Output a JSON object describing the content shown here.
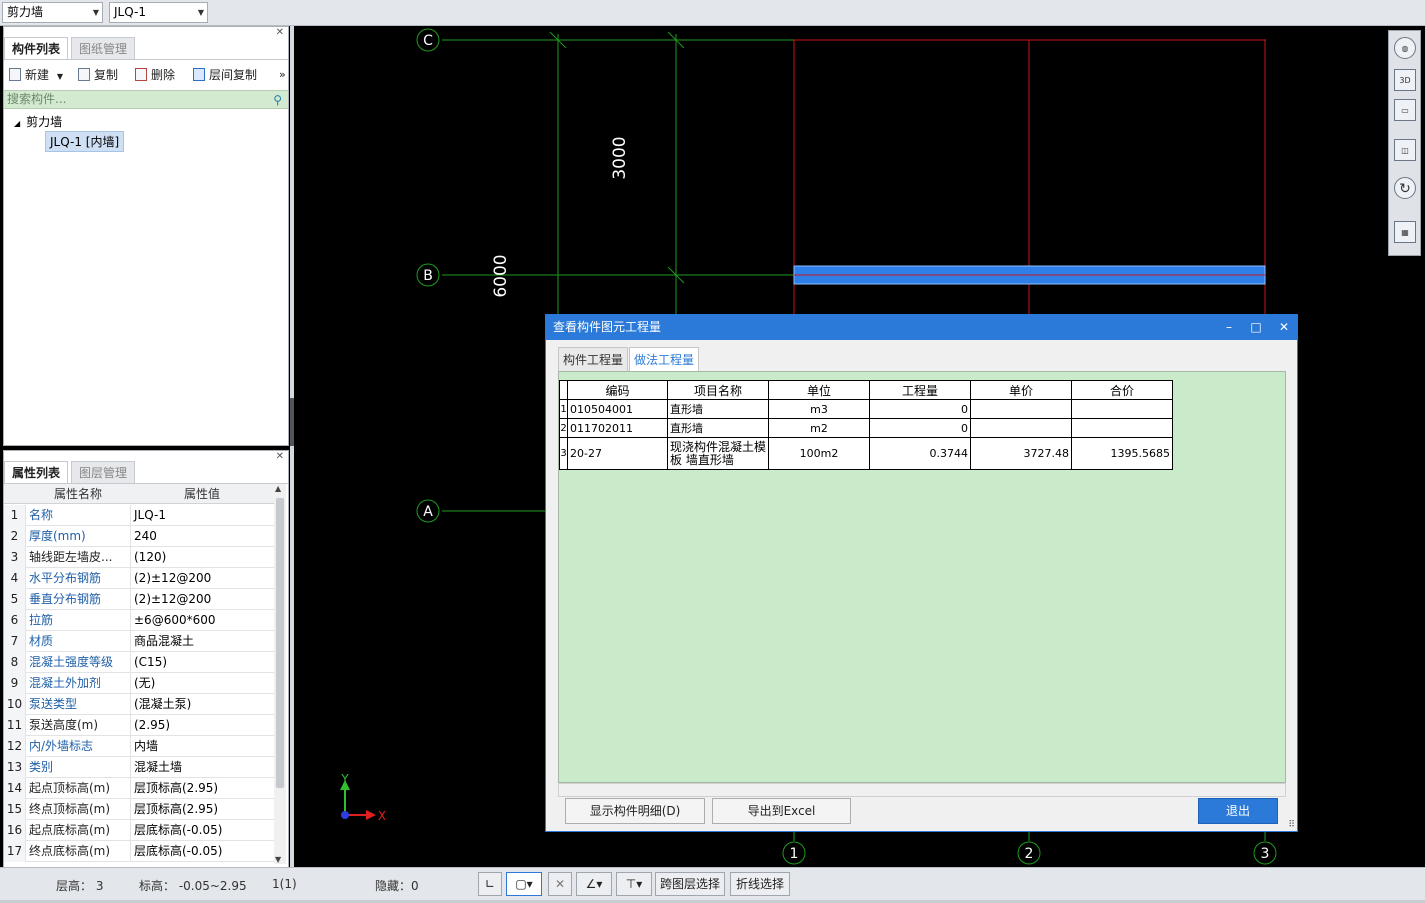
{
  "top_bar": {
    "category_combo": "剪力墙",
    "component_combo": "JLQ-1"
  },
  "component_panel": {
    "tabs": [
      "构件列表",
      "图纸管理"
    ],
    "toolbar": {
      "new_label": "新建",
      "copy_label": "复制",
      "delete_label": "删除",
      "floor_copy_label": "层间复制",
      "more_label": "»"
    },
    "search_placeholder": "搜索构件...",
    "tree": {
      "root": "剪力墙",
      "child": "JLQ-1 [内墙]"
    }
  },
  "property_panel": {
    "tabs": [
      "属性列表",
      "图层管理"
    ],
    "header_name": "属性名称",
    "header_value": "属性值",
    "rows": [
      {
        "num": "1",
        "name": "名称",
        "value": "JLQ-1",
        "blue": true
      },
      {
        "num": "2",
        "name": "厚度(mm)",
        "value": "240",
        "blue": true
      },
      {
        "num": "3",
        "name": "轴线距左墙皮...",
        "value": "(120)",
        "blue": false
      },
      {
        "num": "4",
        "name": "水平分布钢筋",
        "value": "(2)±12@200",
        "blue": true
      },
      {
        "num": "5",
        "name": "垂直分布钢筋",
        "value": "(2)±12@200",
        "blue": true
      },
      {
        "num": "6",
        "name": "拉筋",
        "value": "±6@600*600",
        "blue": true
      },
      {
        "num": "7",
        "name": "材质",
        "value": "商品混凝土",
        "blue": true
      },
      {
        "num": "8",
        "name": "混凝土强度等级",
        "value": "(C15)",
        "blue": true
      },
      {
        "num": "9",
        "name": "混凝土外加剂",
        "value": "(无)",
        "blue": true
      },
      {
        "num": "10",
        "name": "泵送类型",
        "value": "(混凝土泵)",
        "blue": true
      },
      {
        "num": "11",
        "name": "泵送高度(m)",
        "value": "(2.95)",
        "blue": false
      },
      {
        "num": "12",
        "name": "内/外墙标志",
        "value": "内墙",
        "blue": true
      },
      {
        "num": "13",
        "name": "类别",
        "value": "混凝土墙",
        "blue": true
      },
      {
        "num": "14",
        "name": "起点顶标高(m)",
        "value": "层顶标高(2.95)",
        "blue": false
      },
      {
        "num": "15",
        "name": "终点顶标高(m)",
        "value": "层顶标高(2.95)",
        "blue": false
      },
      {
        "num": "16",
        "name": "起点底标高(m)",
        "value": "层底标高(-0.05)",
        "blue": false
      },
      {
        "num": "17",
        "name": "终点底标高(m)",
        "value": "层底标高(-0.05)",
        "blue": false
      }
    ]
  },
  "canvas": {
    "axis_labels": {
      "c": "C",
      "b": "B",
      "a": "A",
      "n1": "1",
      "n2": "2",
      "n3": "3"
    },
    "dim_3000": "3000",
    "dim_6000": "6000",
    "ucs_x": "X",
    "ucs_y": "Y",
    "colors": {
      "grid": "#1f9a1f",
      "wall_red": "#c8141e",
      "wall_blue": "#2f7fe8"
    }
  },
  "view_tools": {
    "label_3d": "3D"
  },
  "dialog": {
    "title": "查看构件图元工程量",
    "minimize": "–",
    "maximize": "□",
    "close": "✕",
    "tabs": [
      "构件工程量",
      "做法工程量"
    ],
    "table": {
      "headers": [
        "编码",
        "项目名称",
        "单位",
        "工程量",
        "单价",
        "合价"
      ],
      "rows": [
        {
          "idx": "1",
          "code": "010504001",
          "name": "直形墙",
          "unit": "m3",
          "qty": "0",
          "price": "",
          "total": ""
        },
        {
          "idx": "2",
          "code": "011702011",
          "name": "直形墙",
          "unit": "m2",
          "qty": "0",
          "price": "",
          "total": ""
        },
        {
          "idx": "3",
          "code": "20-27",
          "name": "现浇构件混凝土模板 墙直形墙",
          "unit": "100m2",
          "qty": "0.3744",
          "price": "3727.48",
          "total": "1395.5685"
        }
      ]
    },
    "btn_detail": "显示构件明细(D)",
    "btn_excel": "导出到Excel",
    "btn_exit": "退出"
  },
  "status_bar": {
    "floor_height": "层高： 3",
    "elevation": "标高： -0.05~2.95",
    "count": "1(1)",
    "hidden": "隐藏：0",
    "cross_layer_select": "跨图层选择",
    "polyline_select": "折线选择"
  }
}
